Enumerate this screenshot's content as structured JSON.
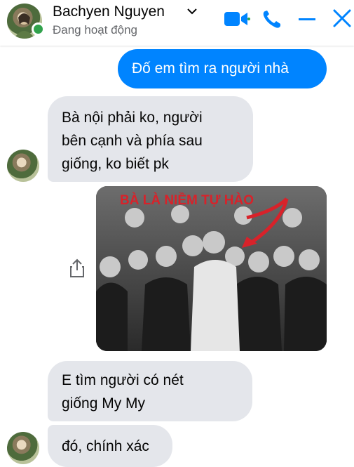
{
  "header": {
    "name": "Bachyen Nguyen",
    "status": "Đang hoạt động",
    "icons": [
      "chevron-down-icon",
      "video-call-icon",
      "phone-icon",
      "minimize-icon",
      "close-icon"
    ],
    "accent_color": "#0084ff"
  },
  "messages": [
    {
      "from": "me",
      "text": "Đố em tìm ra người nhà"
    },
    {
      "from": "them",
      "lines": [
        "Bà nội phải ko, người",
        "bên cạnh và phía sau",
        "giống, ko biết pk"
      ]
    },
    {
      "from": "them",
      "type": "image",
      "caption": "BÀ LÀ NIỀM TỰ HÀO"
    },
    {
      "from": "them",
      "lines": [
        "E tìm người có nét",
        "giống My My"
      ]
    },
    {
      "from": "them",
      "text": "đó, chính xác"
    }
  ],
  "share_icon": "share-icon"
}
